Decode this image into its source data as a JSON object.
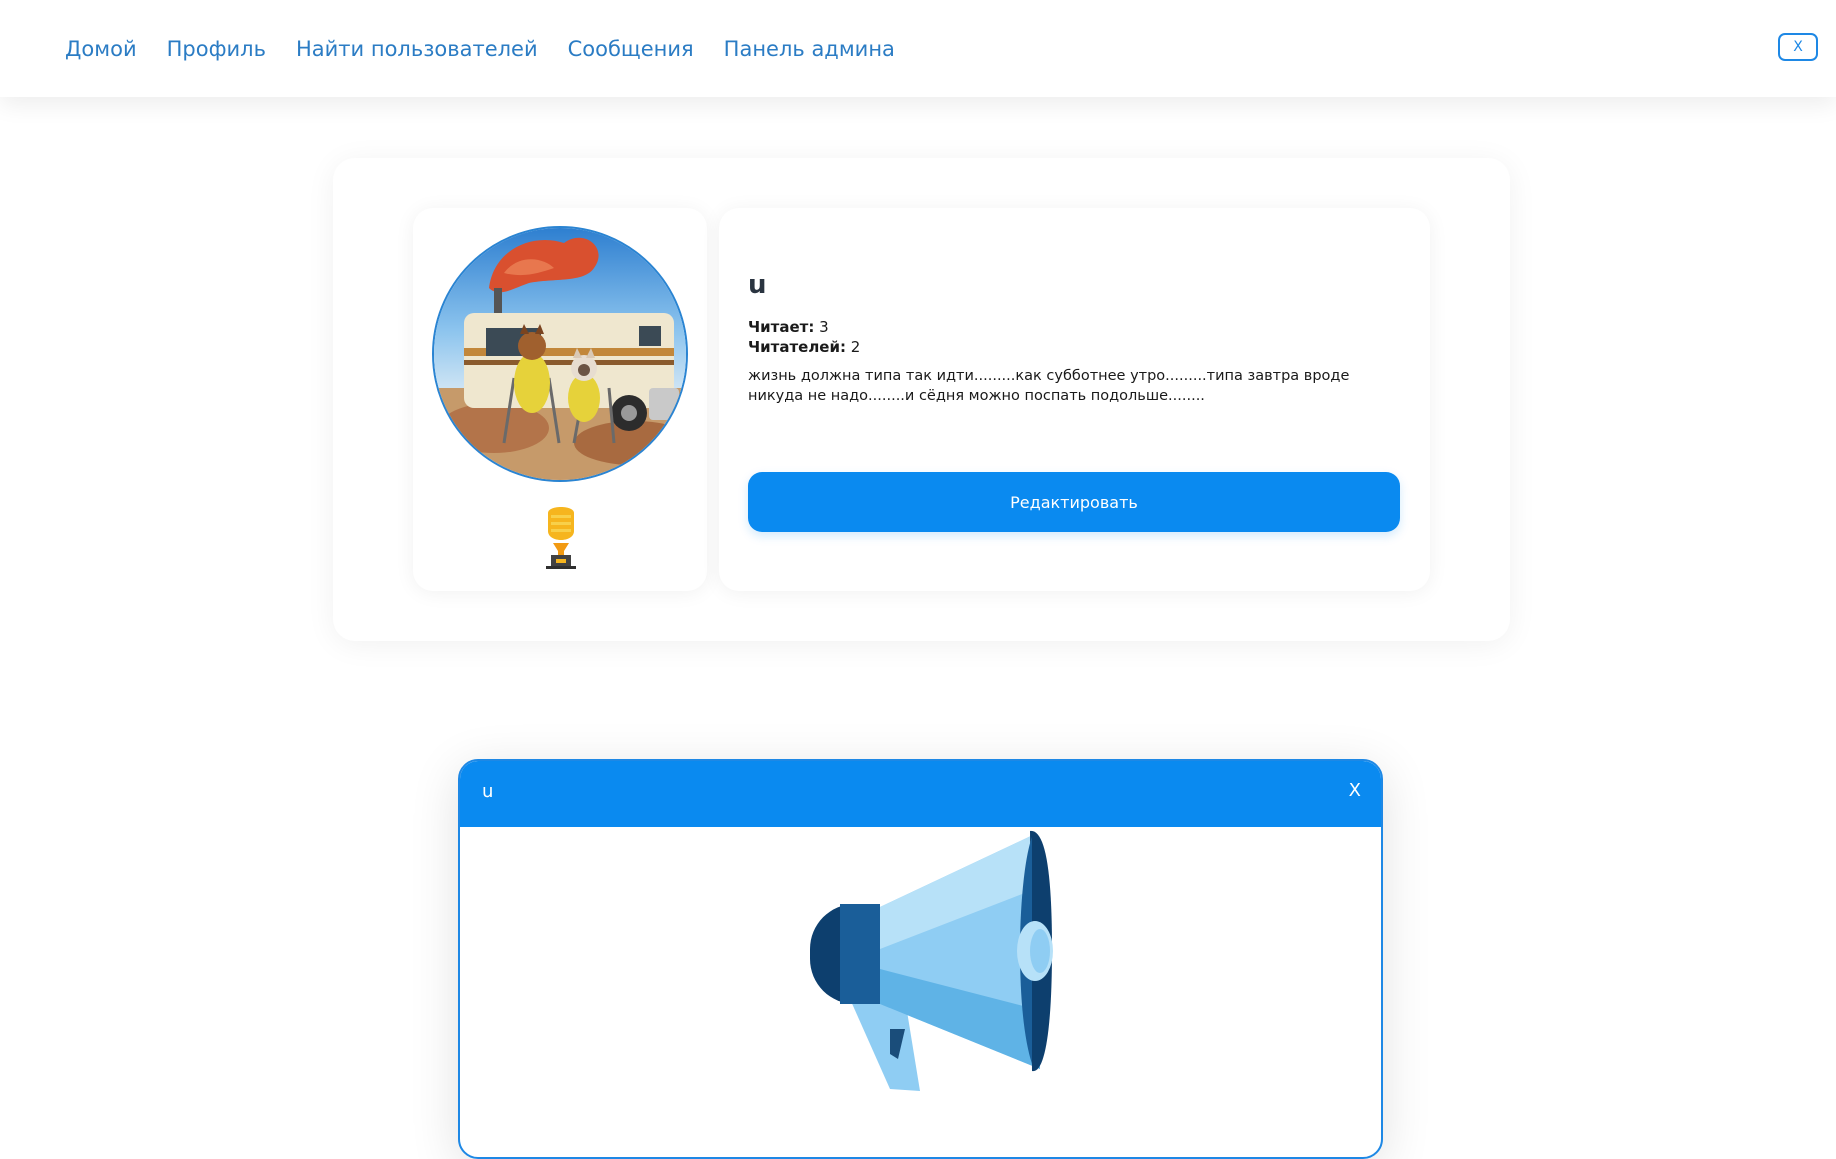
{
  "nav": {
    "links": [
      "Домой",
      "Профиль",
      "Найти пользователей",
      "Сообщения",
      "Панель админа"
    ],
    "close_label": "X"
  },
  "profile": {
    "username": "u",
    "following_label": "Читает:",
    "following_count": "3",
    "followers_label": "Читателей:",
    "followers_count": "2",
    "bio": "жизнь должна типа так идти.........как субботнее утро.........типа завтра вроде никуда не надо........и сёдня можно поспать подольше........",
    "edit_label": "Редактировать"
  },
  "modal": {
    "title": "u",
    "close_label": "X"
  },
  "icons": {
    "avatar": "avatar-photo",
    "badge": "trophy-icon",
    "modal_image": "megaphone-icon"
  },
  "colors": {
    "accent": "#0a8af0",
    "link": "#2b7cc4"
  }
}
